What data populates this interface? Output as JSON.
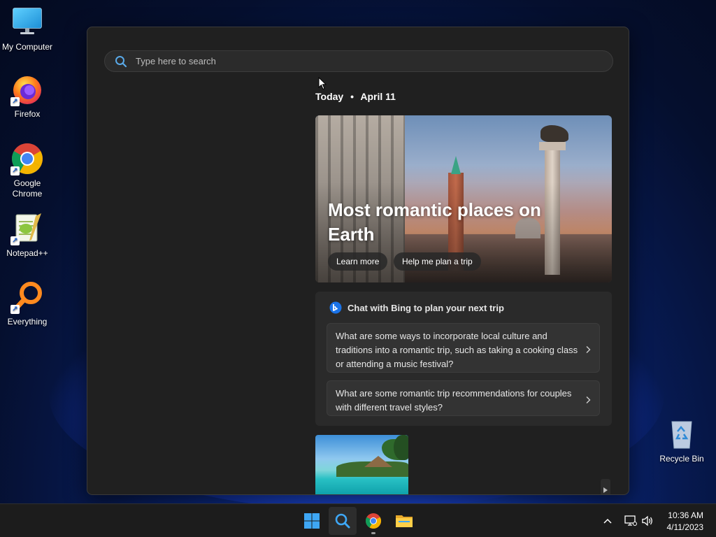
{
  "desktop": {
    "icons": [
      {
        "label": "My Computer"
      },
      {
        "label": "Firefox"
      },
      {
        "label": "Google Chrome"
      },
      {
        "label": "Notepad++"
      },
      {
        "label": "Everything"
      },
      {
        "label": "Recycle Bin"
      }
    ]
  },
  "search": {
    "placeholder": "Type here to search",
    "date_today": "Today",
    "date_separator": "•",
    "date_value": "April 11"
  },
  "hero": {
    "title": "Most romantic places on Earth",
    "learn_more": "Learn more",
    "plan_trip": "Help me plan a trip"
  },
  "chat": {
    "heading": "Chat with Bing to plan your next trip",
    "suggestions": [
      "What are some ways to incorporate local culture and traditions into a romantic trip, such as taking a cooking class or attending a music festival?",
      "What are some romantic trip recommendations for couples with different travel styles?"
    ]
  },
  "taskbar": {
    "time": "10:36 AM",
    "date": "4/11/2023",
    "apps": [
      "start-icon",
      "search-icon",
      "chrome-icon",
      "file-explorer-icon"
    ]
  },
  "colors": {
    "panel_bg": "#202020",
    "card_bg": "#2a2a2a",
    "accent": "#0078d4"
  }
}
